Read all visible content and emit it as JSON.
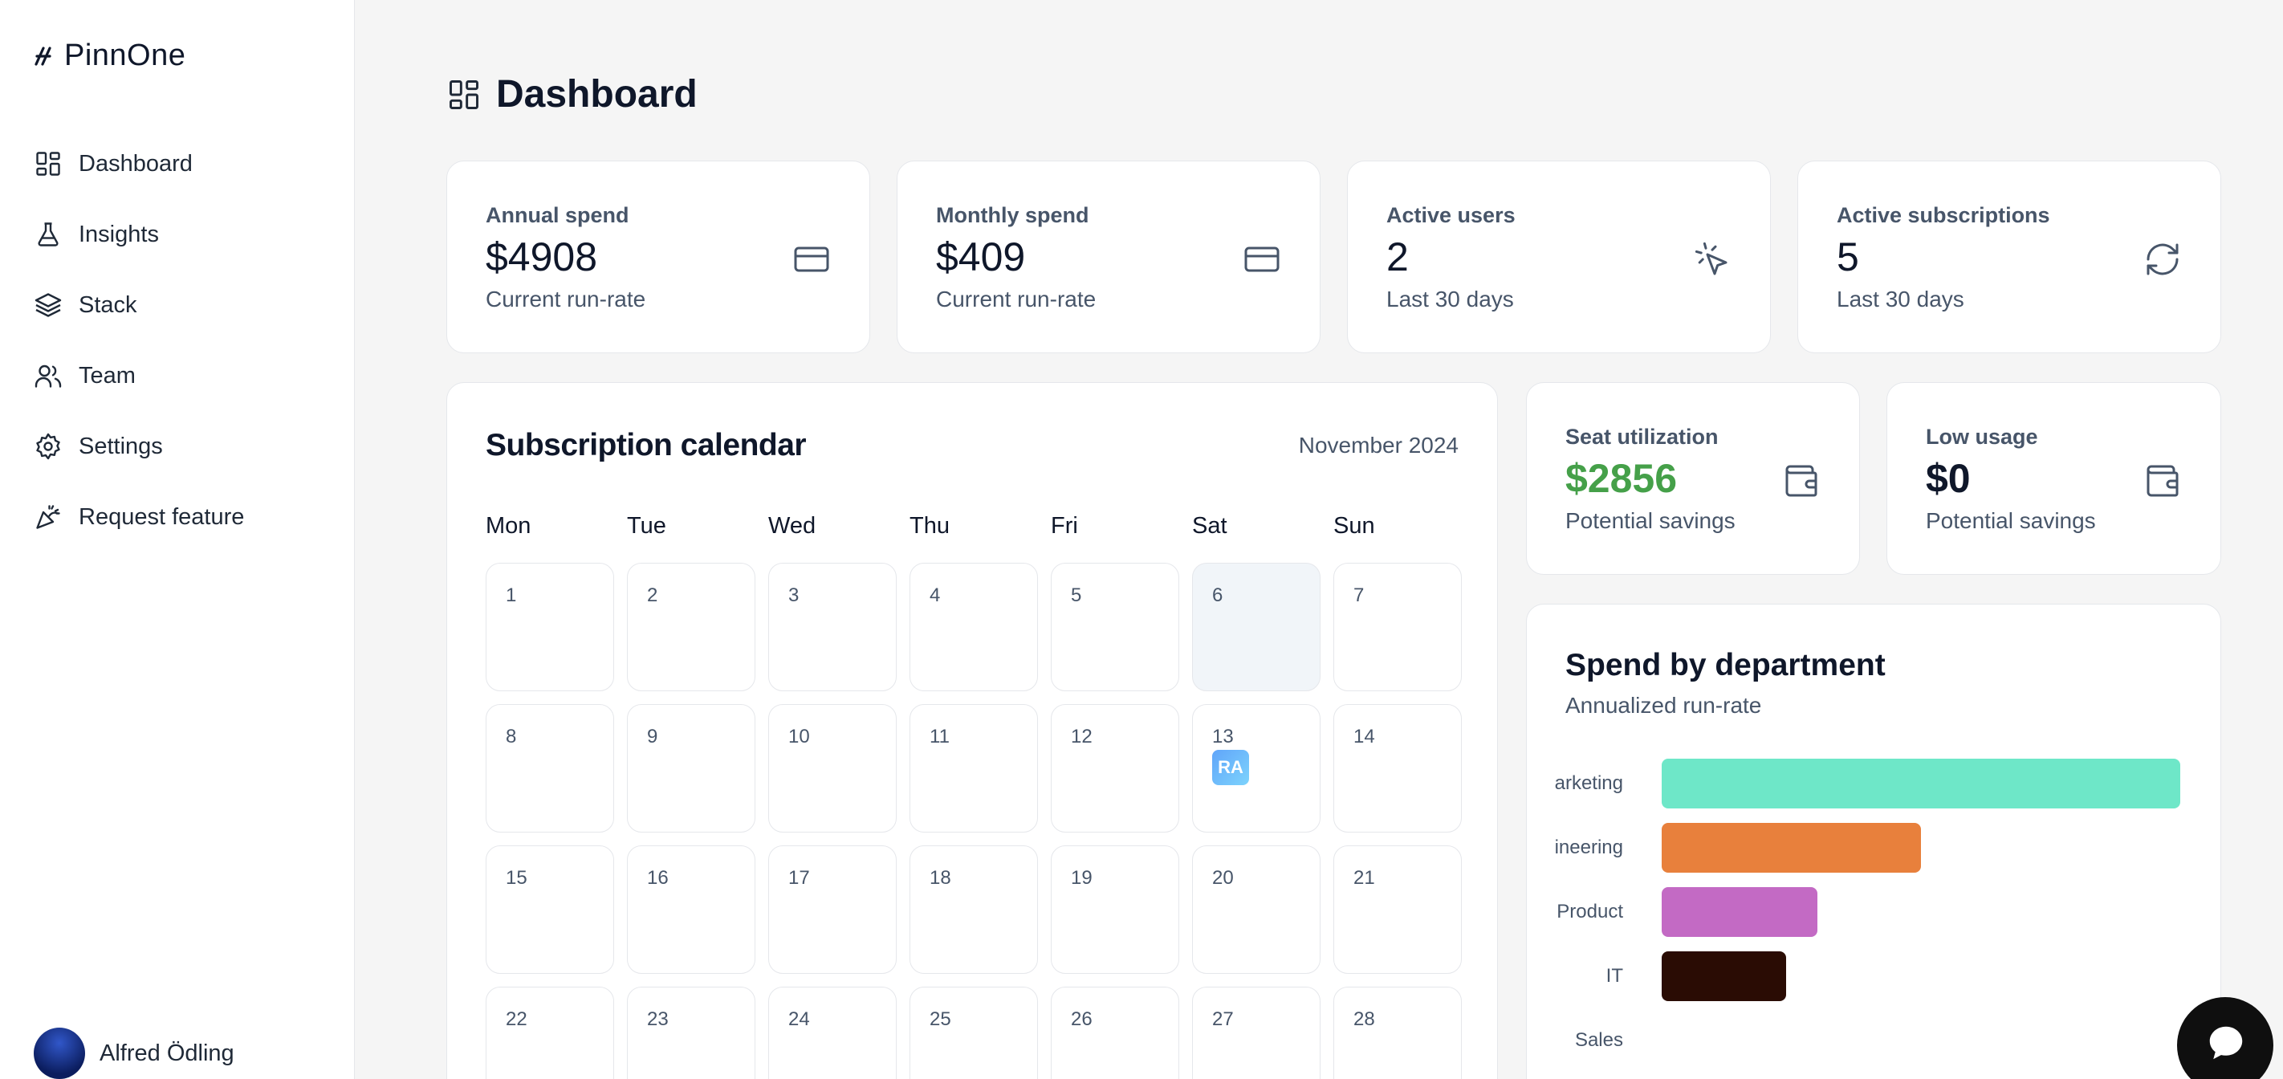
{
  "brand": {
    "name": "PinnOne"
  },
  "sidebar": {
    "items": [
      {
        "label": "Dashboard",
        "icon": "layout-grid-icon"
      },
      {
        "label": "Insights",
        "icon": "flask-icon"
      },
      {
        "label": "Stack",
        "icon": "layers-icon"
      },
      {
        "label": "Team",
        "icon": "users-icon"
      },
      {
        "label": "Settings",
        "icon": "gear-icon"
      },
      {
        "label": "Request feature",
        "icon": "party-popper-icon"
      }
    ],
    "user": {
      "name": "Alfred Ödling"
    }
  },
  "page": {
    "title": "Dashboard"
  },
  "stats": [
    {
      "label": "Annual spend",
      "value": "$4908",
      "sub": "Current run-rate",
      "icon": "credit-card-icon"
    },
    {
      "label": "Monthly spend",
      "value": "$409",
      "sub": "Current run-rate",
      "icon": "credit-card-icon"
    },
    {
      "label": "Active users",
      "value": "2",
      "sub": "Last 30 days",
      "icon": "pointer-click-icon"
    },
    {
      "label": "Active subscriptions",
      "value": "5",
      "sub": "Last 30 days",
      "icon": "refresh-icon"
    }
  ],
  "calendar": {
    "title": "Subscription calendar",
    "month": "November 2024",
    "weekdays": [
      "Mon",
      "Tue",
      "Wed",
      "Thu",
      "Fri",
      "Sat",
      "Sun"
    ],
    "weeks": [
      [
        "1",
        "2",
        "3",
        "4",
        "5",
        "6",
        "7"
      ],
      [
        "8",
        "9",
        "10",
        "11",
        "12",
        "13",
        "14"
      ],
      [
        "15",
        "16",
        "17",
        "18",
        "19",
        "20",
        "21"
      ],
      [
        "22",
        "23",
        "24",
        "25",
        "26",
        "27",
        "28"
      ]
    ],
    "today": "6",
    "event": {
      "day": "13",
      "label": "RA"
    }
  },
  "savings": [
    {
      "label": "Seat utilization",
      "value": "$2856",
      "sub": "Potential savings",
      "color": "#45a049",
      "icon": "wallet-icon"
    },
    {
      "label": "Low usage",
      "value": "$0",
      "sub": "Potential savings",
      "color": "#0f172a",
      "icon": "wallet-icon"
    }
  ],
  "department_chart": {
    "title": "Spend by department",
    "subtitle": "Annualized run-rate"
  },
  "chart_data": {
    "type": "bar",
    "orientation": "horizontal",
    "categories": [
      "Marketing",
      "Engineering",
      "Product",
      "IT",
      "Sales"
    ],
    "visible_labels": [
      "arketing",
      "ineering",
      "Product",
      "IT",
      "Sales"
    ],
    "values": [
      100,
      50,
      30,
      24,
      0
    ],
    "colors": [
      "#6ee7c8",
      "#e8803c",
      "#c36ac4",
      "#2a0c04",
      "#cccccc"
    ],
    "title": "Spend by department",
    "subtitle": "Annualized run-rate",
    "grid": false,
    "legend": "none"
  }
}
